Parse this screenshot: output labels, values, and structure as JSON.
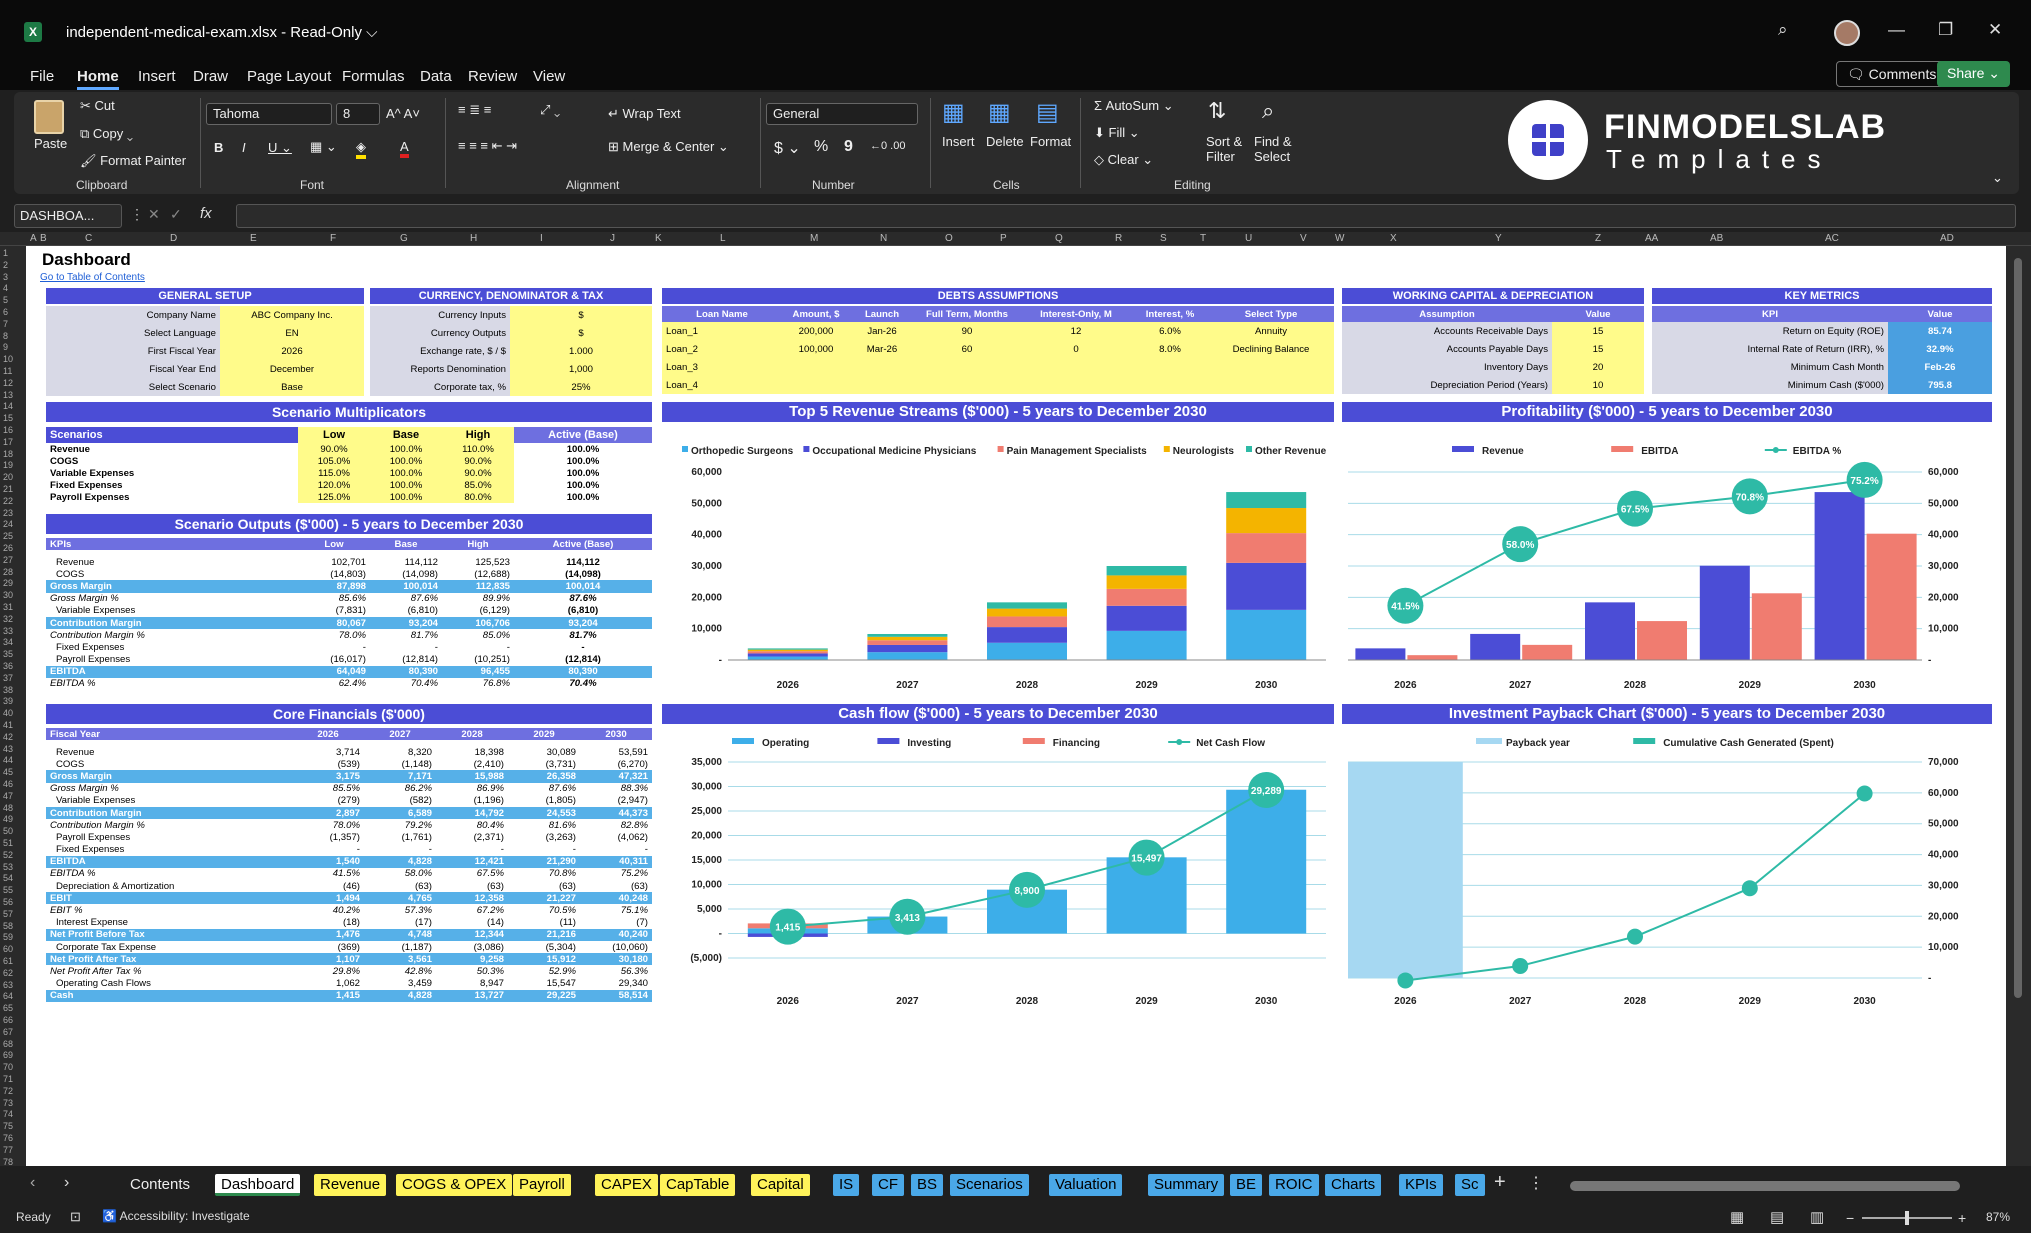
{
  "window": {
    "title": "independent-medical-exam.xlsx - Read-Only ⌵",
    "app_icon": "X"
  },
  "menu": [
    "File",
    "Home",
    "Insert",
    "Draw",
    "Page Layout",
    "Formulas",
    "Data",
    "Review",
    "View"
  ],
  "top_buttons": {
    "comments": "Comments",
    "share": "Share"
  },
  "ribbon": {
    "paste": "Paste",
    "cut": "Cut",
    "copy": "Copy",
    "format_painter": "Format Painter",
    "clipboard": "Clipboard",
    "font_name": "Tahoma",
    "font_size": "8",
    "font": "Font",
    "wrap_text": "Wrap Text",
    "merge_center": "Merge & Center",
    "alignment": "Alignment",
    "number_format": "General",
    "number": "Number",
    "dollar": "$",
    "percent": "%",
    "comma": "9",
    "insert": "Insert",
    "delete": "Delete",
    "format": "Format",
    "cells": "Cells",
    "autosum": "AutoSum",
    "fill": "Fill",
    "clear": "Clear",
    "sort_filter": "Sort &\nFilter",
    "find_select": "Find &\nSelect",
    "editing": "Editing",
    "logo_line1": "FINMODELSLAB",
    "logo_line2": "Templates"
  },
  "namebox": "DASHBOA...",
  "col_headers": [
    "A",
    "B",
    "C",
    "D",
    "E",
    "F",
    "G",
    "H",
    "I",
    "J",
    "K",
    "L",
    "M",
    "N",
    "O",
    "P",
    "Q",
    "R",
    "S",
    "T",
    "U",
    "V",
    "W",
    "X",
    "Y",
    "Z",
    "AA",
    "AB",
    "AC",
    "AD"
  ],
  "sheet": {
    "title": "Dashboard",
    "link": "Go to Table of Contents",
    "general_setup": {
      "title": "GENERAL SETUP",
      "rows": [
        [
          "Company Name",
          "ABC Company Inc."
        ],
        [
          "Select Language",
          "EN"
        ],
        [
          "First Fiscal Year",
          "2026"
        ],
        [
          "Fiscal Year End",
          "December"
        ],
        [
          "Select Scenario",
          "Base"
        ]
      ]
    },
    "currency": {
      "title": "CURRENCY, DENOMINATOR & TAX",
      "rows": [
        [
          "Currency Inputs",
          "$"
        ],
        [
          "Currency Outputs",
          "$"
        ],
        [
          "Exchange rate, $ / $",
          "1.000"
        ],
        [
          "Reports Denomination",
          "1,000"
        ],
        [
          "Corporate tax, %",
          "25%"
        ]
      ]
    },
    "debts": {
      "title": "DEBTS ASSUMPTIONS",
      "headers": [
        "Loan Name",
        "Amount, $",
        "Launch",
        "Full Term, Months",
        "Interest-Only, M",
        "Interest, %",
        "Select Type"
      ],
      "rows": [
        [
          "Loan_1",
          "200,000",
          "Jan-26",
          "90",
          "12",
          "6.0%",
          "Annuity"
        ],
        [
          "Loan_2",
          "100,000",
          "Mar-26",
          "60",
          "0",
          "8.0%",
          "Declining Balance"
        ],
        [
          "Loan_3",
          "",
          "",
          "",
          "",
          "",
          ""
        ],
        [
          "Loan_4",
          "",
          "",
          "",
          "",
          "",
          ""
        ]
      ]
    },
    "working_capital": {
      "title": "WORKING CAPITAL & DEPRECIATION",
      "headers": [
        "Assumption",
        "Value"
      ],
      "rows": [
        [
          "Accounts Receivable Days",
          "15"
        ],
        [
          "Accounts Payable Days",
          "15"
        ],
        [
          "Inventory Days",
          "20"
        ],
        [
          "Depreciation Period (Years)",
          "10"
        ]
      ]
    },
    "key_metrics": {
      "title": "KEY METRICS",
      "headers": [
        "KPI",
        "Value"
      ],
      "rows": [
        [
          "Return on Equity (ROE)",
          "85.74"
        ],
        [
          "Internal Rate of Return (IRR), %",
          "32.9%"
        ],
        [
          "Minimum Cash Month",
          "Feb-26"
        ],
        [
          "Minimum Cash ($'000)",
          "795.8"
        ]
      ]
    },
    "scenario_mult": {
      "title": "Scenario Multiplicators",
      "headers": [
        "Scenarios",
        "Low",
        "Base",
        "High",
        "Active (Base)"
      ],
      "rows": [
        [
          "Revenue",
          "90.0%",
          "100.0%",
          "110.0%",
          "100.0%"
        ],
        [
          "COGS",
          "105.0%",
          "100.0%",
          "90.0%",
          "100.0%"
        ],
        [
          "Variable Expenses",
          "115.0%",
          "100.0%",
          "90.0%",
          "100.0%"
        ],
        [
          "Fixed Expenses",
          "120.0%",
          "100.0%",
          "85.0%",
          "100.0%"
        ],
        [
          "Payroll Expenses",
          "125.0%",
          "100.0%",
          "80.0%",
          "100.0%"
        ]
      ]
    },
    "scenario_out": {
      "title": "Scenario Outputs ($'000) - 5 years to December 2030",
      "headers": [
        "KPIs",
        "Low",
        "Base",
        "High",
        "Active (Base)"
      ],
      "rows": [
        {
          "c": [
            "Revenue",
            "102,701",
            "114,112",
            "125,523",
            "114,112"
          ],
          "s": ""
        },
        {
          "c": [
            "COGS",
            "(14,803)",
            "(14,098)",
            "(12,688)",
            "(14,098)"
          ],
          "s": ""
        },
        {
          "c": [
            "Gross Margin",
            "87,898",
            "100,014",
            "112,835",
            "100,014"
          ],
          "s": "hl"
        },
        {
          "c": [
            "Gross Margin %",
            "85.6%",
            "87.6%",
            "89.9%",
            "87.6%"
          ],
          "s": "it"
        },
        {
          "c": [
            "Variable Expenses",
            "(7,831)",
            "(6,810)",
            "(6,129)",
            "(6,810)"
          ],
          "s": ""
        },
        {
          "c": [
            "Contribution Margin",
            "80,067",
            "93,204",
            "106,706",
            "93,204"
          ],
          "s": "hl"
        },
        {
          "c": [
            "Contribution Margin %",
            "78.0%",
            "81.7%",
            "85.0%",
            "81.7%"
          ],
          "s": "it"
        },
        {
          "c": [
            "Fixed Expenses",
            "-",
            "-",
            "-",
            "-"
          ],
          "s": ""
        },
        {
          "c": [
            "Payroll Expenses",
            "(16,017)",
            "(12,814)",
            "(10,251)",
            "(12,814)"
          ],
          "s": ""
        },
        {
          "c": [
            "EBITDA",
            "64,049",
            "80,390",
            "96,455",
            "80,390"
          ],
          "s": "hl"
        },
        {
          "c": [
            "EBITDA %",
            "62.4%",
            "70.4%",
            "76.8%",
            "70.4%"
          ],
          "s": "it"
        }
      ]
    },
    "core": {
      "title": "Core Financials ($'000)",
      "headers": [
        "Fiscal Year",
        "2026",
        "2027",
        "2028",
        "2029",
        "2030"
      ],
      "rows": [
        {
          "c": [
            "Revenue",
            "3,714",
            "8,320",
            "18,398",
            "30,089",
            "53,591"
          ],
          "s": ""
        },
        {
          "c": [
            "COGS",
            "(539)",
            "(1,148)",
            "(2,410)",
            "(3,731)",
            "(6,270)"
          ],
          "s": ""
        },
        {
          "c": [
            "Gross Margin",
            "3,175",
            "7,171",
            "15,988",
            "26,358",
            "47,321"
          ],
          "s": "hl"
        },
        {
          "c": [
            "Gross Margin %",
            "85.5%",
            "86.2%",
            "86.9%",
            "87.6%",
            "88.3%"
          ],
          "s": "it"
        },
        {
          "c": [
            "Variable Expenses",
            "(279)",
            "(582)",
            "(1,196)",
            "(1,805)",
            "(2,947)"
          ],
          "s": ""
        },
        {
          "c": [
            "Contribution Margin",
            "2,897",
            "6,589",
            "14,792",
            "24,553",
            "44,373"
          ],
          "s": "hl"
        },
        {
          "c": [
            "Contribution Margin %",
            "78.0%",
            "79.2%",
            "80.4%",
            "81.6%",
            "82.8%"
          ],
          "s": "it"
        },
        {
          "c": [
            "Payroll Expenses",
            "(1,357)",
            "(1,761)",
            "(2,371)",
            "(3,263)",
            "(4,062)"
          ],
          "s": ""
        },
        {
          "c": [
            "Fixed Expenses",
            "-",
            "-",
            "-",
            "-",
            "-"
          ],
          "s": ""
        },
        {
          "c": [
            "EBITDA",
            "1,540",
            "4,828",
            "12,421",
            "21,290",
            "40,311"
          ],
          "s": "hl"
        },
        {
          "c": [
            "EBITDA %",
            "41.5%",
            "58.0%",
            "67.5%",
            "70.8%",
            "75.2%"
          ],
          "s": "it"
        },
        {
          "c": [
            "Depreciation & Amortization",
            "(46)",
            "(63)",
            "(63)",
            "(63)",
            "(63)"
          ],
          "s": ""
        },
        {
          "c": [
            "EBIT",
            "1,494",
            "4,765",
            "12,358",
            "21,227",
            "40,248"
          ],
          "s": "hl"
        },
        {
          "c": [
            "EBIT %",
            "40.2%",
            "57.3%",
            "67.2%",
            "70.5%",
            "75.1%"
          ],
          "s": "it"
        },
        {
          "c": [
            "Interest Expense",
            "(18)",
            "(17)",
            "(14)",
            "(11)",
            "(7)"
          ],
          "s": ""
        },
        {
          "c": [
            "Net Profit Before Tax",
            "1,476",
            "4,748",
            "12,344",
            "21,216",
            "40,240"
          ],
          "s": "hl"
        },
        {
          "c": [
            "Corporate Tax Expense",
            "(369)",
            "(1,187)",
            "(3,086)",
            "(5,304)",
            "(10,060)"
          ],
          "s": ""
        },
        {
          "c": [
            "Net Profit After Tax",
            "1,107",
            "3,561",
            "9,258",
            "15,912",
            "30,180"
          ],
          "s": "hl"
        },
        {
          "c": [
            "Net Profit After Tax %",
            "29.8%",
            "42.8%",
            "50.3%",
            "52.9%",
            "56.3%"
          ],
          "s": "it"
        },
        {
          "c": [
            "Operating Cash Flows",
            "1,062",
            "3,459",
            "8,947",
            "15,547",
            "29,340"
          ],
          "s": ""
        },
        {
          "c": [
            "Cash",
            "1,415",
            "4,828",
            "13,727",
            "29,225",
            "58,514"
          ],
          "s": "hl"
        }
      ]
    }
  },
  "chart_data": [
    {
      "type": "bar",
      "title": "Top 5 Revenue Streams ($'000) - 5 years to December 2030",
      "categories": [
        "2026",
        "2027",
        "2028",
        "2029",
        "2030"
      ],
      "stacked": true,
      "ylim": [
        0,
        60000
      ],
      "yticks": [
        "-",
        "10,000",
        "20,000",
        "30,000",
        "40,000",
        "50,000",
        "60,000"
      ],
      "series": [
        {
          "name": "Orthopedic Surgeons",
          "color": "#3daee9",
          "values": [
            1100,
            2500,
            5500,
            9300,
            16000
          ]
        },
        {
          "name": "Occupational Medicine Physicians",
          "color": "#4b4dd6",
          "values": [
            1000,
            2300,
            5000,
            8000,
            15000
          ]
        },
        {
          "name": "Pain Management Specialists",
          "color": "#f07c70",
          "values": [
            700,
            1500,
            3400,
            5400,
            9500
          ]
        },
        {
          "name": "Neurologists",
          "color": "#f4b400",
          "values": [
            500,
            1100,
            2500,
            4300,
            8000
          ]
        },
        {
          "name": "Other Revenue",
          "color": "#2ebaa6",
          "values": [
            400,
            900,
            2000,
            3000,
            5100
          ]
        }
      ]
    },
    {
      "type": "bar",
      "title": "Profitability ($'000) - 5 years to December 2030",
      "categories": [
        "2026",
        "2027",
        "2028",
        "2029",
        "2030"
      ],
      "ylim": [
        0,
        60000
      ],
      "yticks": [
        "-",
        "10,000",
        "20,000",
        "30,000",
        "40,000",
        "50,000",
        "60,000"
      ],
      "series": [
        {
          "name": "Revenue",
          "color": "#4b4dd6",
          "values": [
            3714,
            8320,
            18398,
            30089,
            53591
          ]
        },
        {
          "name": "EBITDA",
          "color": "#f07c70",
          "values": [
            1540,
            4828,
            12421,
            21290,
            40311
          ]
        },
        {
          "name": "EBITDA %",
          "color": "#2ebaa6",
          "type": "line",
          "values": [
            41.5,
            58.0,
            67.5,
            70.8,
            75.2
          ],
          "labels": [
            "41.5%",
            "58.0%",
            "67.5%",
            "70.8%",
            "75.2%"
          ]
        }
      ]
    },
    {
      "type": "bar",
      "title": "Cash flow ($'000) - 5 years to December 2030",
      "categories": [
        "2026",
        "2027",
        "2028",
        "2029",
        "2030"
      ],
      "ylim": [
        -5000,
        35000
      ],
      "yticks": [
        "(5,000)",
        "-",
        "5,000",
        "10,000",
        "15,000",
        "20,000",
        "25,000",
        "30,000",
        "35,000"
      ],
      "series": [
        {
          "name": "Operating",
          "color": "#3daee9",
          "values": [
            1062,
            3459,
            8947,
            15547,
            29340
          ]
        },
        {
          "name": "Investing",
          "color": "#4b4dd6",
          "values": [
            -700,
            0,
            0,
            0,
            0
          ]
        },
        {
          "name": "Financing",
          "color": "#f07c70",
          "values": [
            1000,
            0,
            0,
            0,
            0
          ]
        },
        {
          "name": "Net Cash Flow",
          "color": "#2ebaa6",
          "type": "line",
          "values": [
            1415,
            3413,
            8900,
            15497,
            29289
          ],
          "labels": [
            "1,415",
            "3,413",
            "8,900",
            "15,497",
            "29,289"
          ]
        }
      ]
    },
    {
      "type": "line",
      "title": "Investment Payback Chart ($'000) - 5 years to December 2030",
      "categories": [
        "2026",
        "2027",
        "2028",
        "2029",
        "2030"
      ],
      "ylim": [
        0,
        70000
      ],
      "yticks": [
        "-",
        "10,000",
        "20,000",
        "30,000",
        "40,000",
        "50,000",
        "60,000",
        "70,000"
      ],
      "series": [
        {
          "name": "Payback year",
          "color": "#a6d8f2",
          "type": "bar",
          "values": [
            70000,
            0,
            0,
            0,
            0
          ]
        },
        {
          "name": "Cumulative Cash Generated (Spent)",
          "color": "#2ebaa6",
          "values": [
            -800,
            3900,
            13400,
            29100,
            59800
          ]
        }
      ]
    }
  ],
  "tabs": [
    {
      "label": "Contents",
      "color": ""
    },
    {
      "label": "Dashboard",
      "color": "active"
    },
    {
      "label": "Revenue",
      "color": "#fff35a"
    },
    {
      "label": "COGS & OPEX",
      "color": "#fff35a"
    },
    {
      "label": "Payroll",
      "color": "#fff35a"
    },
    {
      "label": "CAPEX",
      "color": "#fff35a"
    },
    {
      "label": "CapTable",
      "color": "#fff35a"
    },
    {
      "label": "Capital",
      "color": "#fff35a"
    },
    {
      "label": "IS",
      "color": "#4aa8e8"
    },
    {
      "label": "CF",
      "color": "#4aa8e8"
    },
    {
      "label": "BS",
      "color": "#4aa8e8"
    },
    {
      "label": "Scenarios",
      "color": "#4aa8e8"
    },
    {
      "label": "Valuation",
      "color": "#4aa8e8"
    },
    {
      "label": "Summary",
      "color": "#4aa8e8"
    },
    {
      "label": "BE",
      "color": "#4aa8e8"
    },
    {
      "label": "ROIC",
      "color": "#4aa8e8"
    },
    {
      "label": "Charts",
      "color": "#4aa8e8"
    },
    {
      "label": "KPIs",
      "color": "#4aa8e8"
    },
    {
      "label": "Sc",
      "color": "#4aa8e8"
    }
  ],
  "status": {
    "ready": "Ready",
    "accessibility": "Accessibility: Investigate",
    "zoom": "87%"
  }
}
